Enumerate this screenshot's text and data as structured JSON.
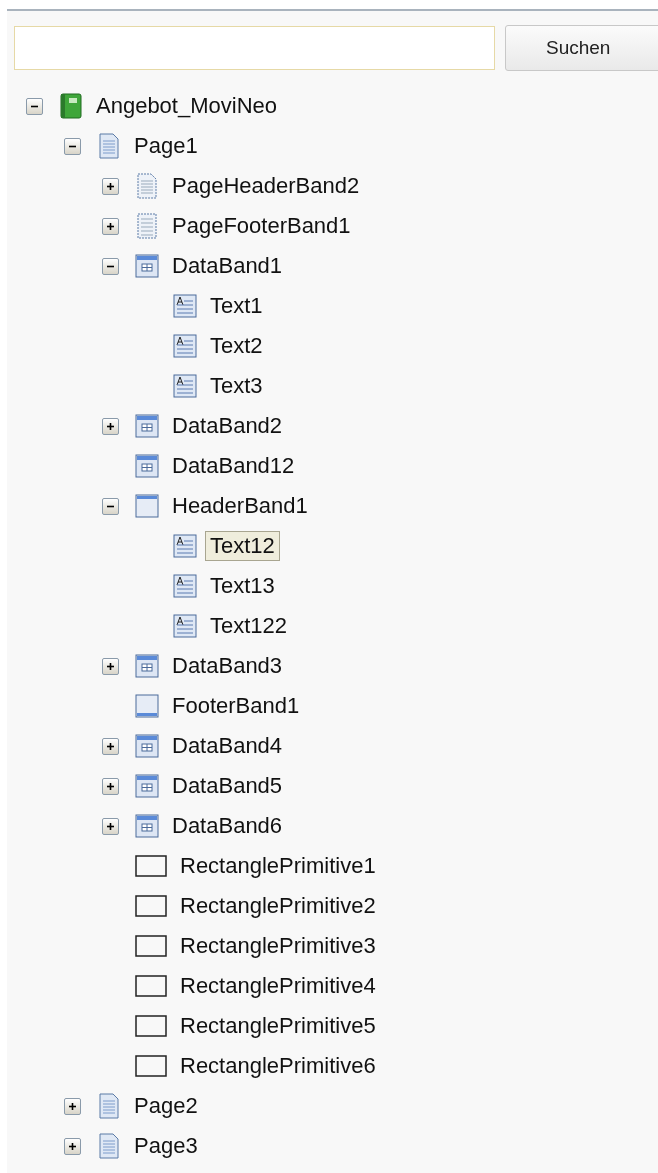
{
  "search": {
    "button": "Suchen"
  },
  "tree": [
    {
      "kind": "report",
      "label": "Angebot_MoviNeo",
      "expanded": true,
      "selected": false,
      "children": [
        {
          "kind": "page",
          "label": "Page1",
          "expanded": true,
          "selected": false,
          "children": [
            {
              "kind": "pageheader",
              "label": "PageHeaderBand2",
              "expanded": false,
              "selected": false
            },
            {
              "kind": "pagefooter",
              "label": "PageFooterBand1",
              "expanded": false,
              "selected": false
            },
            {
              "kind": "databand",
              "label": "DataBand1",
              "expanded": true,
              "selected": false,
              "children": [
                {
                  "kind": "text",
                  "label": "Text1",
                  "selected": false
                },
                {
                  "kind": "text",
                  "label": "Text2",
                  "selected": false
                },
                {
                  "kind": "text",
                  "label": "Text3",
                  "selected": false
                }
              ]
            },
            {
              "kind": "databand",
              "label": "DataBand2",
              "expanded": false,
              "selected": false
            },
            {
              "kind": "databand",
              "label": "DataBand12",
              "selected": false
            },
            {
              "kind": "header",
              "label": "HeaderBand1",
              "expanded": true,
              "selected": false,
              "children": [
                {
                  "kind": "text",
                  "label": "Text12",
                  "selected": true
                },
                {
                  "kind": "text",
                  "label": "Text13",
                  "selected": false
                },
                {
                  "kind": "text",
                  "label": "Text122",
                  "selected": false
                }
              ]
            },
            {
              "kind": "databand",
              "label": "DataBand3",
              "expanded": false,
              "selected": false
            },
            {
              "kind": "footer",
              "label": "FooterBand1",
              "selected": false
            },
            {
              "kind": "databand",
              "label": "DataBand4",
              "expanded": false,
              "selected": false
            },
            {
              "kind": "databand",
              "label": "DataBand5",
              "expanded": false,
              "selected": false
            },
            {
              "kind": "databand",
              "label": "DataBand6",
              "expanded": false,
              "selected": false
            },
            {
              "kind": "rectangle",
              "label": "RectanglePrimitive1",
              "selected": false
            },
            {
              "kind": "rectangle",
              "label": "RectanglePrimitive2",
              "selected": false
            },
            {
              "kind": "rectangle",
              "label": "RectanglePrimitive3",
              "selected": false
            },
            {
              "kind": "rectangle",
              "label": "RectanglePrimitive4",
              "selected": false
            },
            {
              "kind": "rectangle",
              "label": "RectanglePrimitive5",
              "selected": false
            },
            {
              "kind": "rectangle",
              "label": "RectanglePrimitive6",
              "selected": false
            }
          ]
        },
        {
          "kind": "page",
          "label": "Page2",
          "expanded": false,
          "selected": false
        },
        {
          "kind": "page",
          "label": "Page3",
          "expanded": false,
          "selected": false
        }
      ]
    }
  ]
}
